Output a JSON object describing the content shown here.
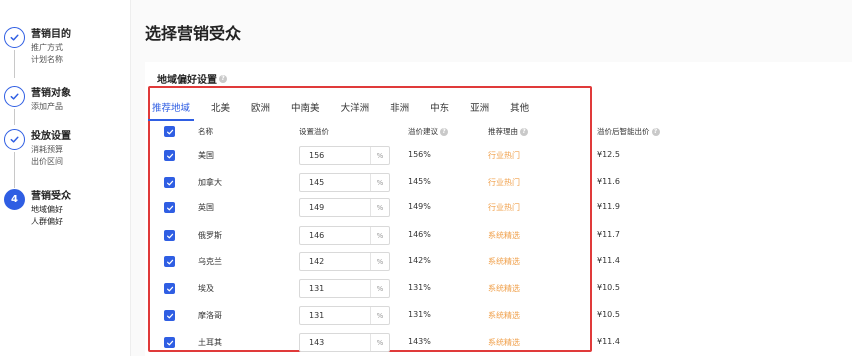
{
  "sidebar": {
    "steps": [
      {
        "title": "营销目的",
        "subs": [
          "推广方式",
          "计划名称"
        ],
        "state": "done"
      },
      {
        "title": "营销对象",
        "subs": [
          "添加产品"
        ],
        "state": "done"
      },
      {
        "title": "投放设置",
        "subs": [
          "消耗预算",
          "出价区间"
        ],
        "state": "done"
      },
      {
        "title": "营销受众",
        "subs": [
          "地域偏好",
          "人群偏好"
        ],
        "state": "current",
        "number": "4"
      }
    ]
  },
  "page": {
    "title": "选择营销受众",
    "section_title": "地域偏好设置"
  },
  "tabs": [
    "推荐地域",
    "北美",
    "欧洲",
    "中南美",
    "大洋洲",
    "非洲",
    "中东",
    "亚洲",
    "其他"
  ],
  "active_tab": "推荐地域",
  "table": {
    "headers": {
      "name": "名称",
      "premium": "设置溢价",
      "suggest": "溢价建议",
      "reason": "推荐理由",
      "price": "溢价后智能出价"
    },
    "unit": "%",
    "rows": [
      {
        "name": "美国",
        "premium": "156",
        "suggest": "156%",
        "reason": "行业热门",
        "price": "¥12.5",
        "checked": true
      },
      {
        "name": "加拿大",
        "premium": "145",
        "suggest": "145%",
        "reason": "行业热门",
        "price": "¥11.6",
        "checked": true
      },
      {
        "name": "英国",
        "premium": "149",
        "suggest": "149%",
        "reason": "行业热门",
        "price": "¥11.9",
        "checked": true
      },
      {
        "name": "俄罗斯",
        "premium": "146",
        "suggest": "146%",
        "reason": "系统精选",
        "price": "¥11.7",
        "checked": true
      },
      {
        "name": "乌克兰",
        "premium": "142",
        "suggest": "142%",
        "reason": "系统精选",
        "price": "¥11.4",
        "checked": true
      },
      {
        "name": "埃及",
        "premium": "131",
        "suggest": "131%",
        "reason": "系统精选",
        "price": "¥10.5",
        "checked": true
      },
      {
        "name": "摩洛哥",
        "premium": "131",
        "suggest": "131%",
        "reason": "系统精选",
        "price": "¥10.5",
        "checked": true
      },
      {
        "name": "土耳其",
        "premium": "143",
        "suggest": "143%",
        "reason": "系统精选",
        "price": "¥11.4",
        "checked": true
      }
    ]
  },
  "colors": {
    "accent": "#2f5ee3",
    "highlight_border": "#e03a3a",
    "reason_text": "#f0a04b"
  }
}
